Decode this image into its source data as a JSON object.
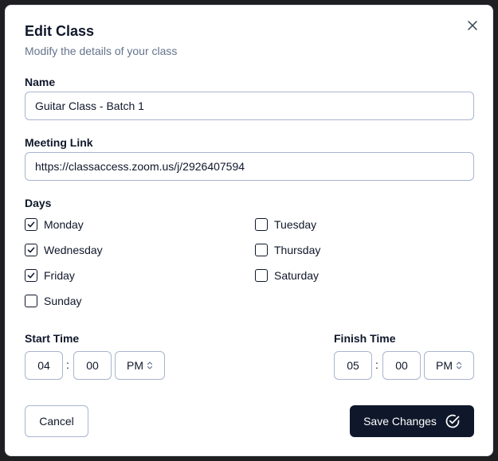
{
  "dialog": {
    "title": "Edit Class",
    "subtitle": "Modify the details of your class",
    "close_icon": "close-icon"
  },
  "form": {
    "name": {
      "label": "Name",
      "value": "Guitar Class - Batch 1"
    },
    "meeting_link": {
      "label": "Meeting Link",
      "value": "https://classaccess.zoom.us/j/2926407594"
    },
    "days": {
      "label": "Days",
      "items": [
        {
          "label": "Monday",
          "checked": true
        },
        {
          "label": "Tuesday",
          "checked": false
        },
        {
          "label": "Wednesday",
          "checked": true
        },
        {
          "label": "Thursday",
          "checked": false
        },
        {
          "label": "Friday",
          "checked": true
        },
        {
          "label": "Saturday",
          "checked": false
        },
        {
          "label": "Sunday",
          "checked": false
        }
      ]
    },
    "start_time": {
      "label": "Start Time",
      "hour": "04",
      "separator": ":",
      "minute": "00",
      "period": "PM"
    },
    "finish_time": {
      "label": "Finish Time",
      "hour": "05",
      "separator": ":",
      "minute": "00",
      "period": "PM"
    }
  },
  "actions": {
    "cancel_label": "Cancel",
    "save_label": "Save Changes",
    "save_icon": "check-circle-icon"
  },
  "colors": {
    "primary": "#0f172a",
    "muted_text": "#64748b",
    "border": "#a8b5cf",
    "backdrop": "#1f1f22"
  }
}
